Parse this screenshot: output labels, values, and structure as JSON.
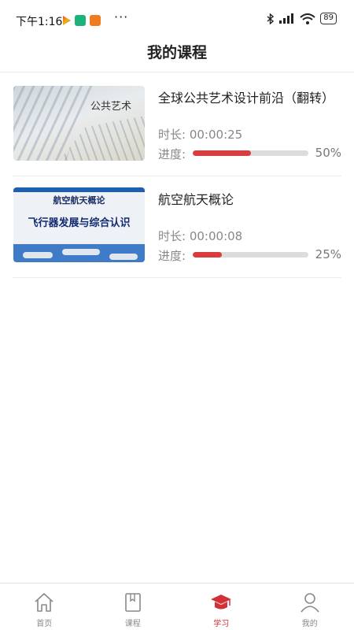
{
  "status_bar": {
    "time": "下午1:16",
    "more": "···",
    "battery": "89"
  },
  "header": {
    "title": "我的课程"
  },
  "courses": [
    {
      "title": "全球公共艺术设计前沿（翻转）",
      "duration_label": "时长:",
      "duration": "00:00:25",
      "progress_label": "进度:",
      "progress": 0.5,
      "progress_text": "50%",
      "thumb_text": "公共艺术"
    },
    {
      "title": "航空航天概论",
      "duration_label": "时长:",
      "duration": "00:00:08",
      "progress_label": "进度:",
      "progress": 0.25,
      "progress_text": "25%",
      "thumb_title": "航空航天概论",
      "thumb_subtitle": "飞行器发展与综合认识"
    }
  ],
  "tabs": [
    {
      "label": "首页",
      "icon": "home-icon",
      "active": false
    },
    {
      "label": "课程",
      "icon": "book-icon",
      "active": false
    },
    {
      "label": "学习",
      "icon": "graduation-cap-icon",
      "active": true
    },
    {
      "label": "我的",
      "icon": "user-icon",
      "active": false
    }
  ],
  "colors": {
    "accent": "#d23237",
    "progress_fill": "#d93b3e",
    "progress_track": "#dcdcdc"
  }
}
